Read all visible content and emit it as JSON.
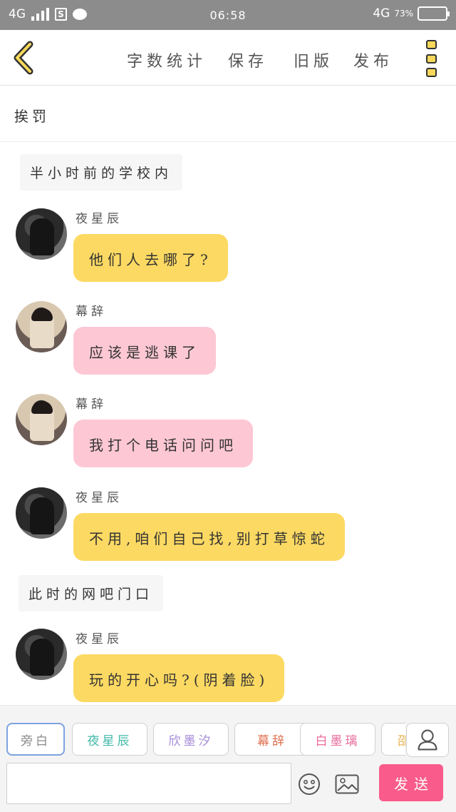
{
  "status_bar": {
    "network_left": "4G",
    "sim_label": "S",
    "time": "06:58",
    "network_right": "4G",
    "battery_percent": "73%",
    "battery_level": 0.73
  },
  "toolbar": {
    "actions": [
      "字数统计",
      "保存",
      "旧版",
      "发布"
    ]
  },
  "document": {
    "title": "挨罚"
  },
  "messages": [
    {
      "type": "narration",
      "text": "半小时前的学校内"
    },
    {
      "type": "chat",
      "speaker": "夜星辰",
      "text": "他们人去哪了?"
    },
    {
      "type": "chat",
      "speaker": "幕辞",
      "text": "应该是逃课了"
    },
    {
      "type": "chat",
      "speaker": "幕辞",
      "text": "我打个电话问问吧"
    },
    {
      "type": "chat",
      "speaker": "夜星辰",
      "text": "不用,咱们自己找,别打草惊蛇"
    },
    {
      "type": "narration",
      "text": "此时的网吧门口"
    },
    {
      "type": "chat",
      "speaker": "夜星辰",
      "text": "玩的开心吗?(阴着脸)"
    }
  ],
  "composer": {
    "role_chips": [
      {
        "label": "旁白",
        "color": "#8a8a8a"
      },
      {
        "label": "夜星辰",
        "color": "#3fb8a8"
      },
      {
        "label": "欣墨汐",
        "color": "#a58bd8"
      },
      {
        "label": "幕辞",
        "color": "#e0704f"
      },
      {
        "label": "白墨璃",
        "color": "#e86a9a"
      },
      {
        "label": "邵",
        "color": "#e8b04a"
      }
    ],
    "input_value": "",
    "send_label": "发送"
  },
  "colors": {
    "yellow_bubble": "#fcd962",
    "pink_bubble": "#fdc7d4",
    "send_button": "#f95b8a",
    "status_bar": "#8c8c8c"
  }
}
